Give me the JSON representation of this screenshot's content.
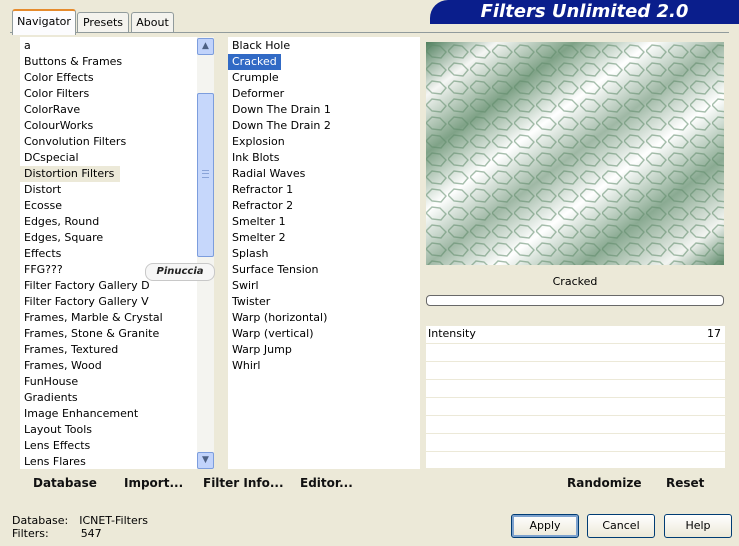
{
  "tabs": [
    {
      "label": "Navigator",
      "active": true
    },
    {
      "label": "Presets",
      "active": false
    },
    {
      "label": "About",
      "active": false
    }
  ],
  "banner": {
    "title": "Filters Unlimited 2.0"
  },
  "categories": {
    "items": [
      "a",
      "Buttons & Frames",
      "Color Effects",
      "Color Filters",
      "ColorRave",
      "ColourWorks",
      "Convolution Filters",
      "DCspecial",
      "Distortion Filters",
      "Distort",
      "Ecosse",
      "Edges, Round",
      "Edges, Square",
      "Effects",
      "FFG???",
      "Filter Factory Gallery D",
      "Filter Factory Gallery V",
      "Frames, Marble & Crystal",
      "Frames, Stone & Granite",
      "Frames, Textured",
      "Frames, Wood",
      "FunHouse",
      "Gradients",
      "Image Enhancement",
      "Layout Tools",
      "Lens Effects",
      "Lens Flares"
    ],
    "selected": "Distortion Filters"
  },
  "watermark": {
    "text": "Pinuccia"
  },
  "filters": {
    "items": [
      "Black Hole",
      "Cracked",
      "Crumple",
      "Deformer",
      "Down The Drain 1",
      "Down The Drain 2",
      "Explosion",
      "Ink Blots",
      "Radial Waves",
      "Refractor 1",
      "Refractor 2",
      "Smelter 1",
      "Smelter 2",
      "Splash",
      "Surface Tension",
      "Swirl",
      "Twister",
      "Warp (horizontal)",
      "Warp (vertical)",
      "Warp Jump",
      "Whirl"
    ],
    "selected": "Cracked"
  },
  "preview": {
    "title": "Cracked",
    "progress": 0
  },
  "params": [
    {
      "name": "Intensity",
      "value": "17"
    }
  ],
  "toolbar": {
    "database": "Database",
    "import": "Import...",
    "filter_info": "Filter Info...",
    "editor": "Editor...",
    "randomize": "Randomize",
    "reset": "Reset"
  },
  "status": {
    "database_label": "Database:",
    "database_value": "ICNET-Filters",
    "filters_label": "Filters:",
    "filters_value": "547"
  },
  "buttons": {
    "apply": "Apply",
    "cancel": "Cancel",
    "help": "Help"
  },
  "colors": {
    "selection": "#316ac5",
    "banner": "#0a1e8c",
    "background": "#ece9d8"
  }
}
